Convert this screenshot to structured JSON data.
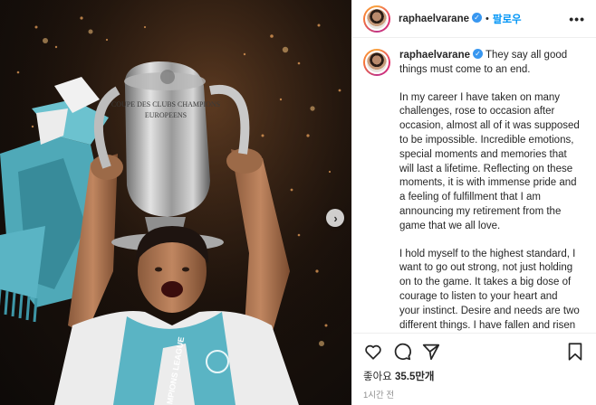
{
  "post": {
    "username": "raphaelvarane",
    "follow_label": "팔로우",
    "more_label": "•••",
    "caption_first": "They say all good things must come to an end.",
    "paragraphs": [
      "In my career I have taken on many challenges, rose to occasion after occasion, almost all of it was supposed to be impossible. Incredible emotions, special moments and memories that will last a lifetime. Reflecting on these moments, it is with immense pride and a feeling of fulfillment that I am announcing my retirement from the game that we all love.",
      "I hold myself to the highest standard, I want to go out strong, not just holding on to the game. It takes a big dose of courage to listen to your heart and your instinct. Desire and needs are two different things. I have fallen and risen a thousand times, and this"
    ],
    "likes_label": "좋아요",
    "likes_count": "35.5만개",
    "time_ago": "1시간 전"
  },
  "photo": {
    "trophy_inscription": "COUPE DES CLUBS CHAMPIONS EUROPEENS",
    "scarf_text": "CHAMPIONS LEAGUE",
    "next_icon": "chevron-right-icon"
  },
  "icons": {
    "like": "heart-icon",
    "comment": "comment-icon",
    "share": "paper-plane-icon",
    "save": "bookmark-icon"
  },
  "colors": {
    "accent": "#0095f6",
    "verified": "#3897f0",
    "scarf": "#5ab4c4"
  }
}
